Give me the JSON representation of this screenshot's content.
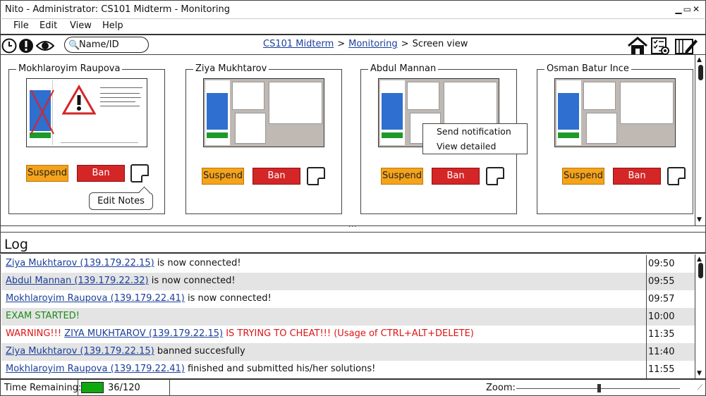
{
  "window": {
    "title": "Nito - Administrator: CS101 Midterm - Monitoring",
    "controls": "▁▭✕"
  },
  "menu": [
    "File",
    "Edit",
    "View",
    "Help"
  ],
  "toolbar": {
    "icons": [
      "clock-icon",
      "alert-icon",
      "eye-icon",
      "home-icon",
      "checklist-icon",
      "edit-notes-icon"
    ],
    "search_placeholder": "Name/ID",
    "breadcrumb": [
      "CS101 Midterm",
      "Monitoring",
      "Screen view"
    ]
  },
  "students": [
    {
      "name": "Mokhlaroyim Raupova"
    },
    {
      "name": "Ziya Mukhtarov"
    },
    {
      "name": "Abdul Mannan"
    },
    {
      "name": "Osman Batur Ince"
    }
  ],
  "actions": {
    "suspend": "Suspend",
    "ban": "Ban"
  },
  "tooltip": "Edit Notes",
  "context_menu": [
    "Send notification",
    "View detailed"
  ],
  "log": {
    "title": "Log",
    "entries": [
      {
        "link": "Ziya Mukhtarov (139.179.22.15)",
        "text": " is now connected!",
        "time": "09:50"
      },
      {
        "link": "Abdul Mannan (139.179.22.32)",
        "text": " is now connected!",
        "time": "09:55"
      },
      {
        "link": "Mokhlaroyim Raupova (139.179.22.41)",
        "text": " is now connected!",
        "time": "09:57"
      },
      {
        "text": "EXAM STARTED!",
        "time": "10:00"
      },
      {
        "prefix": "WARNING!!! ",
        "link": "ZIYA MUKHTAROV (139.179.22.15)",
        "text": " IS TRYING TO CHEAT!!! (Usage of CTRL+ALT+DELETE)",
        "time": "11:35"
      },
      {
        "link": "Ziya Mukhtarov (139.179.22.15)",
        "text": " banned succesfully",
        "time": "11:40"
      },
      {
        "link": "Mokhlaroyim Raupova (139.179.22.41)",
        "text": " finished and submitted his/her solutions!",
        "time": "11:55"
      }
    ]
  },
  "status": {
    "time_label": "Time Remaining:",
    "progress_text": "36/120",
    "progress_fraction": 0.3,
    "zoom_label": "Zoom:",
    "zoom_level": 0.5
  },
  "colors": {
    "suspend": "#f5a31a",
    "ban": "#d42626",
    "link": "#1a3f9a",
    "warning": "#e01414",
    "exam_started": "#1a8c1a",
    "progress": "#0fa80f"
  }
}
